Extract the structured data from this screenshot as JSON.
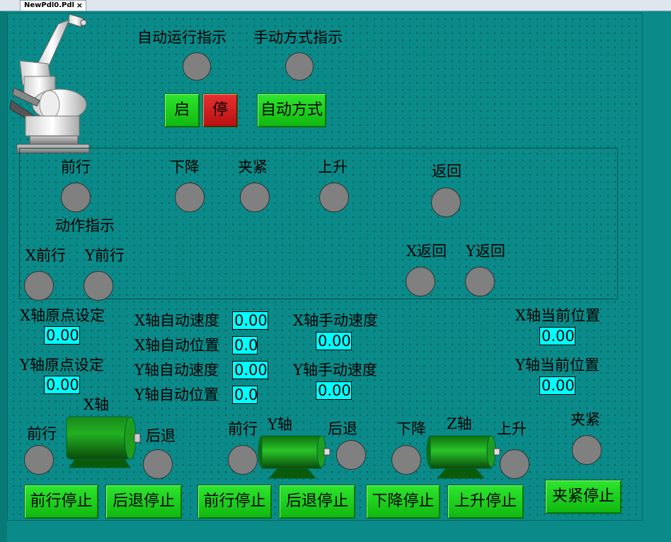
{
  "tab": {
    "title": "NewPdl0.Pdl",
    "close": "×"
  },
  "indicators": {
    "auto_run": "自动运行指示",
    "manual_mode": "手动方式指示"
  },
  "buttons": {
    "start": "启",
    "stop": "停",
    "auto_mode": "自动方式"
  },
  "actions": {
    "forward": "前行",
    "descend": "下降",
    "clamp": "夹紧",
    "ascend": "上升",
    "return": "返回",
    "action_indicator": "动作指示",
    "x_forward": "X前行",
    "y_forward": "Y前行",
    "x_return": "X返回",
    "y_return": "Y返回"
  },
  "settings": {
    "x_origin_label": "X轴原点设定",
    "x_origin_value": "0.00",
    "y_origin_label": "Y轴原点设定",
    "y_origin_value": "0.00",
    "x_auto_speed_label": "X轴自动速度",
    "x_auto_speed_value": "0.00",
    "x_auto_pos_label": "X轴自动位置",
    "x_auto_pos_value": "0.0",
    "y_auto_speed_label": "Y轴自动速度",
    "y_auto_speed_value": "0.00",
    "y_auto_pos_label": "Y轴自动位置",
    "y_auto_pos_value": "0.0",
    "x_manual_speed_label": "X轴手动速度",
    "x_manual_speed_value": "0.00",
    "y_manual_speed_label": "Y轴手动速度",
    "y_manual_speed_value": "0.00",
    "x_current_pos_label": "X轴当前位置",
    "x_current_pos_value": "0.00",
    "y_current_pos_label": "Y轴当前位置",
    "y_current_pos_value": "0.00"
  },
  "motors": {
    "x_axis": "X轴",
    "y_axis": "Y轴",
    "z_axis": "Z轴",
    "forward": "前行",
    "backward": "后退",
    "descend": "下降",
    "ascend": "上升",
    "clamp": "夹紧"
  },
  "bottom_buttons": {
    "fwd_stop": "前行停止",
    "back_stop": "后退停止",
    "descend_stop": "下降停止",
    "ascend_stop": "上升停止",
    "clamp_stop": "夹紧停止"
  },
  "colors": {
    "background": "#0a8a88",
    "button_green": "#1fd01f",
    "button_red": "#d02020",
    "lamp_off": "#808080",
    "value_bg": "#00ffff"
  }
}
